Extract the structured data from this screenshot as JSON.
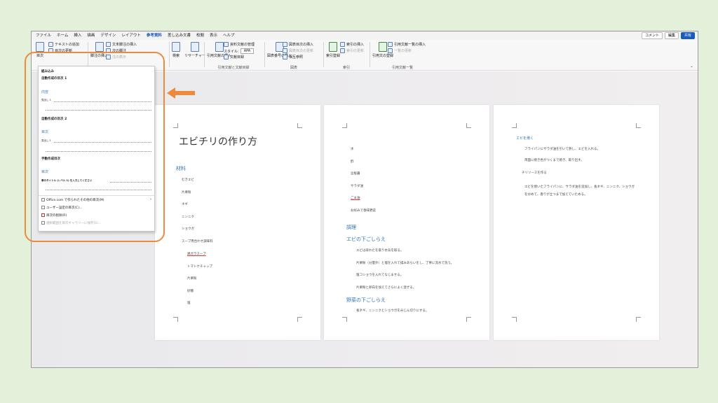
{
  "menu": {
    "tabs": [
      "ファイル",
      "ホーム",
      "挿入",
      "描画",
      "デザイン",
      "レイアウト",
      "参考資料",
      "差し込み文書",
      "校閲",
      "表示",
      "ヘルプ"
    ],
    "active_tab": "参考資料",
    "comment": "コメント",
    "edit": "編集",
    "share": "共有"
  },
  "ribbon": {
    "toc_group": {
      "btn": "目次",
      "add_text": "テキストの追加",
      "update": "目次の更新"
    },
    "footnote_group": {
      "insert_footnote": "脚注の挿入",
      "insert_endnote": "文末脚注の挿入",
      "next_footnote": "次の脚注",
      "show_notes": "注の表示"
    },
    "research_group": {
      "search": "検索",
      "researcher": "リサーチャー"
    },
    "citations_group": {
      "insert_citation": "引用文献の挿入",
      "manage_sources": "資料文献の管理",
      "style_label": "スタイル:",
      "style_value": "APA",
      "bibliography": "文献目録",
      "label": "引用文献と文献目録"
    },
    "captions_group": {
      "insert_caption": "図表番号の挿入",
      "insert_table_of_figures": "図表目次の挿入",
      "update_table": "図表目次の更新",
      "cross_reference": "相互参照",
      "label": "図表"
    },
    "index_group": {
      "mark_entry": "索引登録",
      "insert_index": "索引の挿入",
      "update_index": "索引の更新",
      "label": "索引"
    },
    "authorities_group": {
      "mark_citation": "引用文の登録",
      "insert_table": "引用文献一覧の挿入",
      "update_table": "一覧の更新",
      "label": "引用文献一覧"
    }
  },
  "dropdown": {
    "builtin": "組み込み",
    "auto1": "自動作成の目次 1",
    "content": "内容",
    "heading1": "見出し 1",
    "auto2": "自動作成の目次 2",
    "toc": "目次",
    "manual": "手動作成目次",
    "manual_toc": "目次",
    "manual_entry": "章のタイトル (レベル 1) を入力してください",
    "more_office": "Office.com で作られたその他の目次(M)",
    "custom": "ユーザー設定の目次(C)...",
    "remove": "目次の削除(R)",
    "save_gallery": "選択範囲を目次ギャラリーに保存(S)..."
  },
  "pages": {
    "p1": {
      "title": "エビチリの作り方",
      "materials": "材料",
      "items": [
        "むきエビ",
        "片栗粉",
        "ネギ",
        "ニンニク",
        "ショウガ"
      ],
      "sauce": "スープ用合わせ調味料",
      "sauce_items": [
        "鶏ガラスープ",
        "トマトケチャップ",
        "片栗粉",
        "砂糖",
        "塩"
      ]
    },
    "p2": {
      "items": [
        "水",
        "酢",
        "豆板醤",
        "サラダ油",
        "ごま油",
        "お好みで香味野菜"
      ],
      "method": "調理",
      "prep_shrimp": "エビの下ごしらえ",
      "steps": [
        "エビは背わたを取り水気を取る。",
        "片栗粉（分量外）と塩を入れて揉みあらいをし、丁寧に流水で洗う。",
        "塩コショウを入れてなじませる。",
        "片栗粉と卵白を加えてさらによく混ぜる。"
      ],
      "prep_veg": "野菜の下ごしらえ",
      "veg_step": "長ネギ、ニンニクとショウガをみじん切りにする。"
    },
    "p3": {
      "fry": "エビを焼く",
      "steps": [
        "フライパンにサラダ油を引いて熱し、エビを入れる。",
        "両面に焼き色がつくまで焼き、取り出す。"
      ],
      "sauce": "チリソースを作る",
      "sauce_step": "エビを焼いたフライパンに、サラダ油を追加し、長ネギ、ニンニク、ショウガを炒めて、香りが立つまで加えていためる。"
    }
  },
  "colors": {
    "highlight": "#ee8a3e",
    "accent": "#185abd",
    "heading": "#2e74b5"
  }
}
